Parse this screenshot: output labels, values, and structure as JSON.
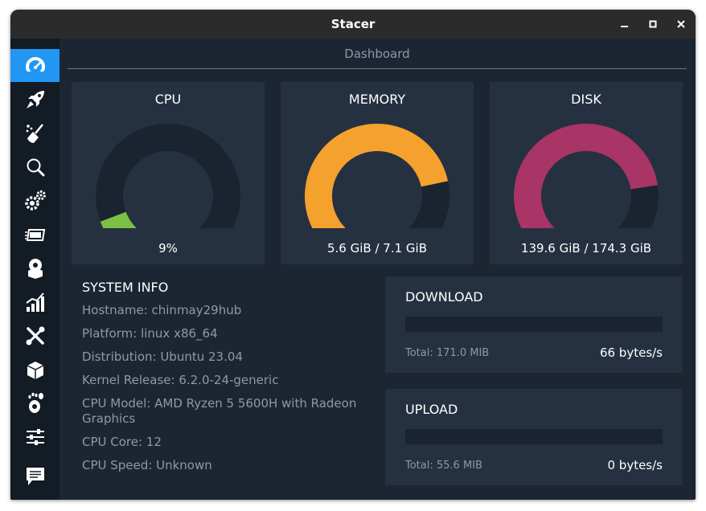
{
  "window": {
    "title": "Stacer"
  },
  "titlebar_buttons": [
    "minimize-icon",
    "maximize-icon",
    "close-icon"
  ],
  "sidebar": {
    "active_index": 0,
    "accent": "#2196f3",
    "items": [
      "dashboard-icon",
      "rocket-icon",
      "broom-cleaner-icon",
      "search-icon",
      "gears-icon",
      "cards-stack-icon",
      "disk-package-icon",
      "chart-bars-icon",
      "tools-icon",
      "box-icon",
      "gnome-foot-icon",
      "sliders-icon",
      "message-icon"
    ]
  },
  "dashboard": {
    "title": "Dashboard"
  },
  "gauges": {
    "cpu": {
      "title": "CPU",
      "value": "9%",
      "percent": 9,
      "color": "#7bc043"
    },
    "memory": {
      "title": "MEMORY",
      "value": "5.6 GiB / 7.1 GiB",
      "percent": 78.9,
      "color": "#f5a12d"
    },
    "disk": {
      "title": "DISK",
      "value": "139.6 GiB / 174.3 GiB",
      "percent": 80.1,
      "color": "#a83565"
    }
  },
  "system_info": {
    "title": "SYSTEM INFO",
    "hostname": "Hostname: chinmay29hub",
    "platform": "Platform: linux x86_64",
    "distribution": "Distribution: Ubuntu 23.04",
    "kernel": "Kernel Release: 6.2.0-24-generic",
    "cpu_model": "CPU Model:  AMD Ryzen 5 5600H with Radeon Graphics",
    "cpu_core": "CPU Core: 12",
    "cpu_speed": "CPU Speed: Unknown"
  },
  "download": {
    "title": "DOWNLOAD",
    "total": "Total: 171.0 MIB",
    "rate": "66 bytes/s"
  },
  "upload": {
    "title": "UPLOAD",
    "total": "Total: 55.6 MIB",
    "rate": "0 bytes/s"
  }
}
